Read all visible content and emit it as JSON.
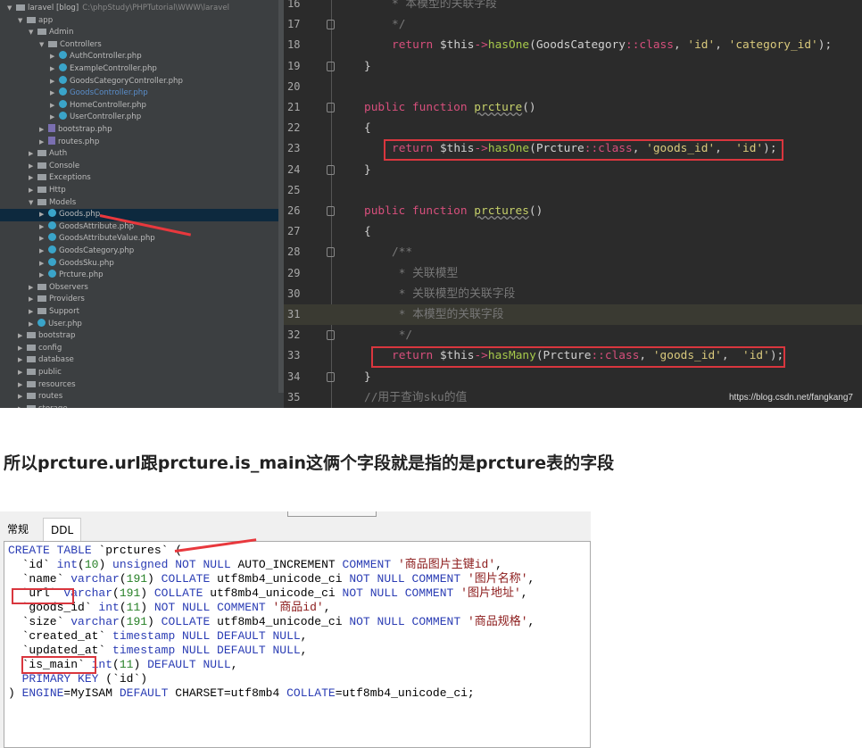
{
  "ide": {
    "tree": [
      {
        "depth": 0,
        "type": "folder",
        "open": true,
        "label": "laravel [blog]",
        "path": "C:\\phpStudy\\PHPTutorial\\WWW\\laravel"
      },
      {
        "depth": 1,
        "type": "folder",
        "open": true,
        "label": "app"
      },
      {
        "depth": 2,
        "type": "folder",
        "open": true,
        "label": "Admin"
      },
      {
        "depth": 3,
        "type": "folder",
        "open": true,
        "label": "Controllers"
      },
      {
        "depth": 4,
        "type": "class",
        "label": "AuthController.php"
      },
      {
        "depth": 4,
        "type": "class",
        "label": "ExampleController.php"
      },
      {
        "depth": 4,
        "type": "class",
        "label": "GoodsCategoryController.php"
      },
      {
        "depth": 4,
        "type": "class",
        "label": "GoodsController.php",
        "highlight": true
      },
      {
        "depth": 4,
        "type": "class",
        "label": "HomeController.php"
      },
      {
        "depth": 4,
        "type": "class",
        "label": "UserController.php"
      },
      {
        "depth": 3,
        "type": "php",
        "label": "bootstrap.php"
      },
      {
        "depth": 3,
        "type": "php",
        "label": "routes.php"
      },
      {
        "depth": 2,
        "type": "folder",
        "label": "Auth"
      },
      {
        "depth": 2,
        "type": "folder",
        "label": "Console"
      },
      {
        "depth": 2,
        "type": "folder",
        "label": "Exceptions"
      },
      {
        "depth": 2,
        "type": "folder",
        "label": "Http"
      },
      {
        "depth": 2,
        "type": "folder",
        "open": true,
        "label": "Models"
      },
      {
        "depth": 3,
        "type": "class",
        "label": "Goods.php",
        "selected": true
      },
      {
        "depth": 3,
        "type": "class",
        "label": "GoodsAttribute.php"
      },
      {
        "depth": 3,
        "type": "class",
        "label": "GoodsAttributeValue.php"
      },
      {
        "depth": 3,
        "type": "class",
        "label": "GoodsCategory.php"
      },
      {
        "depth": 3,
        "type": "class",
        "label": "GoodsSku.php"
      },
      {
        "depth": 3,
        "type": "class",
        "label": "Prcture.php"
      },
      {
        "depth": 2,
        "type": "folder",
        "label": "Observers"
      },
      {
        "depth": 2,
        "type": "folder",
        "label": "Providers"
      },
      {
        "depth": 2,
        "type": "folder",
        "label": "Support"
      },
      {
        "depth": 2,
        "type": "class",
        "label": "User.php"
      },
      {
        "depth": 1,
        "type": "folder",
        "label": "bootstrap"
      },
      {
        "depth": 1,
        "type": "folder",
        "label": "config"
      },
      {
        "depth": 1,
        "type": "folder",
        "label": "database"
      },
      {
        "depth": 1,
        "type": "folder",
        "label": "public"
      },
      {
        "depth": 1,
        "type": "folder",
        "label": "resources"
      },
      {
        "depth": 1,
        "type": "folder",
        "label": "routes"
      },
      {
        "depth": 1,
        "type": "folder",
        "label": "storage"
      }
    ],
    "code": [
      {
        "n": "16",
        "indent": 2,
        "t": [
          [
            "* 本模型的关联字段",
            "cm"
          ]
        ]
      },
      {
        "n": "17",
        "indent": 2,
        "fold": true,
        "t": [
          [
            "*/",
            "cm"
          ]
        ]
      },
      {
        "n": "18",
        "indent": 2,
        "t": [
          [
            "return ",
            "kw"
          ],
          [
            "$this",
            "pl"
          ],
          [
            "->",
            "kw"
          ],
          [
            "hasOne",
            "fn"
          ],
          [
            "(GoodsCategory",
            "pl"
          ],
          [
            "::class",
            "kw"
          ],
          [
            ", ",
            "pl"
          ],
          [
            "'id'",
            "str"
          ],
          [
            ", ",
            "pl"
          ],
          [
            "'category_id'",
            "str"
          ],
          [
            ");",
            "pl"
          ]
        ]
      },
      {
        "n": "19",
        "indent": 1,
        "fold": true,
        "t": [
          [
            "}",
            "pl"
          ]
        ]
      },
      {
        "n": "20",
        "indent": 0,
        "t": []
      },
      {
        "n": "21",
        "indent": 1,
        "fold": true,
        "t": [
          [
            "public function ",
            "kw"
          ],
          [
            "prcture",
            "fname"
          ],
          [
            "()",
            "pl"
          ]
        ]
      },
      {
        "n": "22",
        "indent": 1,
        "t": [
          [
            "{",
            "pl"
          ]
        ]
      },
      {
        "n": "23",
        "indent": 2,
        "box": true,
        "t": [
          [
            "return ",
            "kw"
          ],
          [
            "$this",
            "pl"
          ],
          [
            "->",
            "kw"
          ],
          [
            "hasOne",
            "fn"
          ],
          [
            "(Prcture",
            "pl"
          ],
          [
            "::class",
            "kw"
          ],
          [
            ", ",
            "pl"
          ],
          [
            "'goods_id'",
            "str"
          ],
          [
            ",  ",
            "pl"
          ],
          [
            "'id'",
            "str"
          ],
          [
            ");",
            "pl"
          ]
        ]
      },
      {
        "n": "24",
        "indent": 1,
        "fold": true,
        "t": [
          [
            "}",
            "pl"
          ]
        ]
      },
      {
        "n": "25",
        "indent": 0,
        "t": []
      },
      {
        "n": "26",
        "indent": 1,
        "fold": true,
        "t": [
          [
            "public function ",
            "kw"
          ],
          [
            "prctures",
            "fname"
          ],
          [
            "()",
            "pl"
          ]
        ]
      },
      {
        "n": "27",
        "indent": 1,
        "t": [
          [
            "{",
            "pl"
          ]
        ]
      },
      {
        "n": "28",
        "indent": 2,
        "fold": true,
        "t": [
          [
            "/**",
            "cm"
          ]
        ]
      },
      {
        "n": "29",
        "indent": 2,
        "t": [
          [
            " * 关联模型",
            "cm"
          ]
        ]
      },
      {
        "n": "30",
        "indent": 2,
        "t": [
          [
            " * 关联模型的关联字段",
            "cm"
          ]
        ]
      },
      {
        "n": "31",
        "indent": 2,
        "current": true,
        "t": [
          [
            " * 本模型的关联字段",
            "cm"
          ]
        ]
      },
      {
        "n": "32",
        "indent": 2,
        "fold": true,
        "t": [
          [
            " */",
            "cm"
          ]
        ]
      },
      {
        "n": "33",
        "indent": 2,
        "box": true,
        "t": [
          [
            "return ",
            "kw"
          ],
          [
            "$this",
            "pl"
          ],
          [
            "->",
            "kw"
          ],
          [
            "hasMany",
            "fn"
          ],
          [
            "(Prcture",
            "pl"
          ],
          [
            "::class",
            "kw"
          ],
          [
            ", ",
            "pl"
          ],
          [
            "'goods_id'",
            "str"
          ],
          [
            ",  ",
            "pl"
          ],
          [
            "'id'",
            "str"
          ],
          [
            ");",
            "pl"
          ]
        ]
      },
      {
        "n": "34",
        "indent": 1,
        "fold": true,
        "t": [
          [
            "}",
            "pl"
          ]
        ]
      },
      {
        "n": "35",
        "indent": 1,
        "t": [
          [
            "//用于查询sku的值",
            "cm"
          ]
        ]
      }
    ],
    "watermark": "https://blog.csdn.net/fangkang7"
  },
  "caption": "所以prcture.url跟prcture.is_main这俩个字段就是指的是prcture表的字段",
  "db": {
    "tabs": [
      "常规",
      "DDL"
    ],
    "active_tab": "DDL",
    "ddl": [
      [
        [
          "CREATE TABLE ",
          "k"
        ],
        [
          "`prctures` (",
          "p"
        ]
      ],
      [
        [
          "  `id` ",
          "p"
        ],
        [
          "int",
          "k"
        ],
        [
          "(",
          "p"
        ],
        [
          "10",
          "n"
        ],
        [
          ") ",
          "p"
        ],
        [
          "unsigned NOT NULL ",
          "k"
        ],
        [
          "AUTO_INCREMENT ",
          "p"
        ],
        [
          "COMMENT ",
          "k"
        ],
        [
          "'商品图片主键id'",
          "s"
        ],
        [
          ",",
          "p"
        ]
      ],
      [
        [
          "  `name` ",
          "p"
        ],
        [
          "varchar",
          "k"
        ],
        [
          "(",
          "p"
        ],
        [
          "191",
          "n"
        ],
        [
          ") ",
          "p"
        ],
        [
          "COLLATE ",
          "k"
        ],
        [
          "utf8mb4_unicode_ci ",
          "p"
        ],
        [
          "NOT NULL COMMENT ",
          "k"
        ],
        [
          "'图片名称'",
          "s"
        ],
        [
          ",",
          "p"
        ]
      ],
      [
        [
          "  `url` ",
          "p"
        ],
        [
          "varchar",
          "k"
        ],
        [
          "(",
          "p"
        ],
        [
          "191",
          "n"
        ],
        [
          ") ",
          "p"
        ],
        [
          "COLLATE ",
          "k"
        ],
        [
          "utf8mb4_unicode_ci ",
          "p"
        ],
        [
          "NOT NULL COMMENT ",
          "k"
        ],
        [
          "'图片地址'",
          "s"
        ],
        [
          ",",
          "p"
        ]
      ],
      [
        [
          "  `goods_id` ",
          "p"
        ],
        [
          "int",
          "k"
        ],
        [
          "(",
          "p"
        ],
        [
          "11",
          "n"
        ],
        [
          ") ",
          "p"
        ],
        [
          "NOT NULL COMMENT ",
          "k"
        ],
        [
          "'商品id'",
          "s"
        ],
        [
          ",",
          "p"
        ]
      ],
      [
        [
          "  `size` ",
          "p"
        ],
        [
          "varchar",
          "k"
        ],
        [
          "(",
          "p"
        ],
        [
          "191",
          "n"
        ],
        [
          ") ",
          "p"
        ],
        [
          "COLLATE ",
          "k"
        ],
        [
          "utf8mb4_unicode_ci ",
          "p"
        ],
        [
          "NOT NULL COMMENT ",
          "k"
        ],
        [
          "'商品规格'",
          "s"
        ],
        [
          ",",
          "p"
        ]
      ],
      [
        [
          "  `created_at` ",
          "p"
        ],
        [
          "timestamp NULL DEFAULT NULL",
          "k"
        ],
        [
          ",",
          "p"
        ]
      ],
      [
        [
          "  `updated_at` ",
          "p"
        ],
        [
          "timestamp NULL DEFAULT NULL",
          "k"
        ],
        [
          ",",
          "p"
        ]
      ],
      [
        [
          "  `is_main` ",
          "p"
        ],
        [
          "int",
          "k"
        ],
        [
          "(",
          "p"
        ],
        [
          "11",
          "n"
        ],
        [
          ") ",
          "p"
        ],
        [
          "DEFAULT NULL",
          "k"
        ],
        [
          ",",
          "p"
        ]
      ],
      [
        [
          "  ",
          "p"
        ],
        [
          "PRIMARY KEY ",
          "k"
        ],
        [
          "(`id`)",
          "p"
        ]
      ],
      [
        [
          ") ",
          "p"
        ],
        [
          "ENGINE",
          "k"
        ],
        [
          "=MyISAM ",
          "p"
        ],
        [
          "DEFAULT ",
          "k"
        ],
        [
          "CHARSET",
          "p"
        ],
        [
          "=utf8mb4 ",
          "p"
        ],
        [
          "COLLATE",
          "k"
        ],
        [
          "=utf8mb4_unicode_ci;",
          "p"
        ]
      ]
    ]
  },
  "colors": {
    "annotation_red": "#e8383d",
    "ide_bg": "#2b2b2b",
    "tree_bg": "#3c3f41"
  }
}
